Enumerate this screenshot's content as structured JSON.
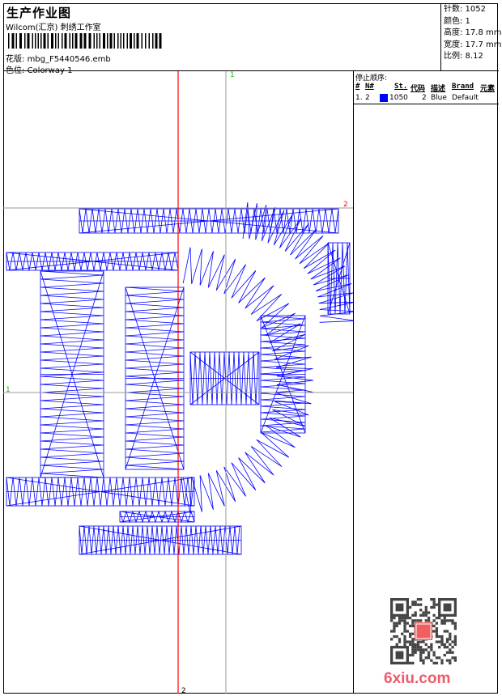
{
  "header": {
    "title": "生产作业图",
    "company": "Wilcom(汇京) 刺绣工作室",
    "file_label": "花版:",
    "file_name": "mbg_F5440546.emb",
    "colorway_label": "色位:",
    "colorway": "Colorway 1"
  },
  "info": {
    "stitches": "针数: 1052",
    "colors": "颜色: 1",
    "height": "高度: 17.8 mm",
    "width": "宽度: 17.7 mm",
    "scale": "比例: 8.12"
  },
  "stop_sequence": {
    "caption": "停止顺序:",
    "headers": [
      "#",
      "N#",
      "St.",
      "代码",
      "描述",
      "Brand",
      "元素"
    ],
    "rows": [
      {
        "index": "1.",
        "n": "2",
        "color": "#0000ff",
        "stitches": "1050",
        "code": "2",
        "description": "Blue",
        "brand": "Default"
      }
    ]
  },
  "markers": {
    "top_1": "1",
    "left_1": "1",
    "right_2": "2",
    "bottom_2": "2"
  },
  "colors": {
    "stitch": "#0000ff",
    "crosshair_red": "#ff0000",
    "crosshair_gray": "#999999",
    "marker_green": "#00cc00"
  },
  "watermark": "6xiu.com"
}
